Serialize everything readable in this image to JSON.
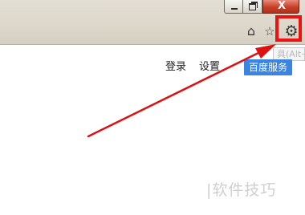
{
  "window": {
    "close_label": "X"
  },
  "toolbar": {
    "home_icon": "home-icon",
    "favorites_icon": "star-icon",
    "tools_icon": "gear-icon",
    "tools_tooltip": "具(Alt+X)"
  },
  "nav": {
    "login": "登录",
    "settings": "设置",
    "baidu_service": "百度服务"
  },
  "annotation": {
    "highlight_color": "#ee1111",
    "arrow_color": "#dd1111"
  },
  "watermark": {
    "text": "|软件技巧"
  }
}
